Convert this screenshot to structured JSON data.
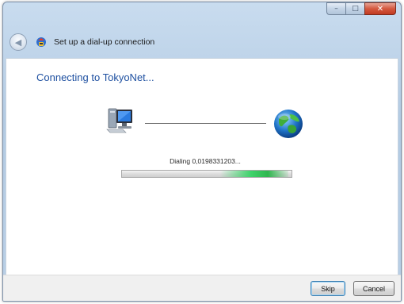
{
  "window": {
    "caption_buttons": {
      "minimize": "–",
      "maximize": "□",
      "close": "✕"
    }
  },
  "header": {
    "title": "Set up a dial-up connection",
    "back_icon": "back-arrow-icon",
    "app_icon": "dialup-connection-icon"
  },
  "main": {
    "heading": "Connecting to TokyoNet...",
    "status_text": "Dialing 0,0198331203...",
    "progress": {
      "style": "marquee",
      "segment_start": 0.58,
      "segment_end": 0.98
    },
    "icons": [
      "computer-icon",
      "globe-icon"
    ]
  },
  "footer": {
    "skip_label": "Skip",
    "cancel_label": "Cancel"
  },
  "colors": {
    "heading": "#1d4fa0",
    "progress_fill": "#3fd36b",
    "close_button": "#d4583f"
  }
}
